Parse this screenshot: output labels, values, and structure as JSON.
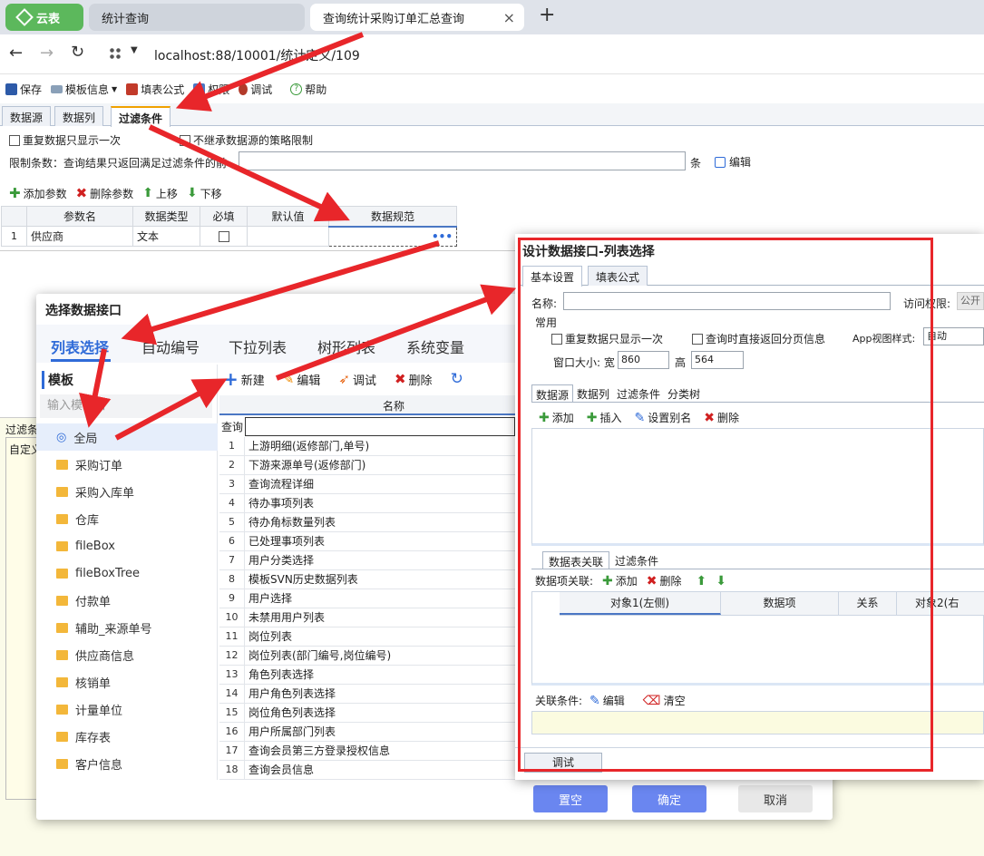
{
  "browser": {
    "tabs": [
      "云表",
      "统计查询",
      "查询统计采购订单汇总查询"
    ],
    "close": "×",
    "new_tab": "+",
    "url": "localhost:88/10001/统计定义/109"
  },
  "toolbar": {
    "save": "保存",
    "template_info": "模板信息",
    "fill_formula": "填表公式",
    "permission": "权限",
    "debug": "调试",
    "help": "帮助"
  },
  "tabs": [
    "数据源",
    "数据列",
    "过滤条件"
  ],
  "options": {
    "dedupe": "重复数据只显示一次",
    "no_inherit": "不继承数据源的策略限制",
    "limit_label": "限制条数：查询结果只返回满足过滤条件的前",
    "limit_unit": "条",
    "edit": "编辑"
  },
  "param_toolbar": {
    "add": "添加参数",
    "remove": "删除参数",
    "up": "上移",
    "down": "下移"
  },
  "param_table": {
    "headers": [
      "参数名",
      "数据类型",
      "必填",
      "默认值",
      "数据规范"
    ],
    "rows": [
      {
        "no": "1",
        "name": "供应商",
        "type": "文本",
        "dots": "•••"
      }
    ]
  },
  "left_peek": {
    "label1": "过滤条",
    "label2": "自定义"
  },
  "select_dialog": {
    "title": "选择数据接口",
    "tabs": [
      "列表选择",
      "自动编号",
      "下拉列表",
      "树形列表",
      "系统变量"
    ],
    "tree_title": "模板",
    "tree_search": "输入模板名",
    "tree_items": [
      "全局",
      "采购订单",
      "采购入库单",
      "仓库",
      "fileBox",
      "fileBoxTree",
      "付款单",
      "辅助_来源单号",
      "供应商信息",
      "核销单",
      "计量单位",
      "库存表",
      "客户信息"
    ],
    "list_toolbar": [
      "新建",
      "编辑",
      "调试",
      "删除"
    ],
    "list_header": "名称",
    "query_label": "查询",
    "list_items": [
      "上游明细(返修部门,单号)",
      "下游来源单号(返修部门)",
      "查询流程详细",
      "待办事项列表",
      "待办角标数量列表",
      "已处理事项列表",
      "用户分类选择",
      "模板SVN历史数据列表",
      "用户选择",
      "未禁用用户列表",
      "岗位列表",
      "岗位列表(部门编号,岗位编号)",
      "角色列表选择",
      "用户角色列表选择",
      "岗位角色列表选择",
      "用户所属部门列表",
      "查询会员第三方登录授权信息",
      "查询会员信息"
    ],
    "buttons": {
      "clear": "置空",
      "ok": "确定",
      "cancel": "取消"
    }
  },
  "design_dialog": {
    "title": "设计数据接口-列表选择",
    "tabs": [
      "基本设置",
      "填表公式"
    ],
    "name_label": "名称:",
    "access_label": "访问权限:",
    "access_value": "公开",
    "group": "常用",
    "dedupe": "重复数据只显示一次",
    "paging": "查询时直接返回分页信息",
    "app_view_label": "App视图样式:",
    "app_view_value": "自动",
    "size_label": "窗口大小: 宽",
    "width": "860",
    "height_label": "高",
    "height": "564",
    "inner_tabs": [
      "数据源",
      "数据列",
      "过滤条件",
      "分类树"
    ],
    "ds_toolbar": [
      "添加",
      "插入",
      "设置别名",
      "删除"
    ],
    "sub_tabs": [
      "数据表关联",
      "过滤条件"
    ],
    "link_label": "数据项关联:",
    "link_add": "添加",
    "link_remove": "删除",
    "link_headers": [
      "对象1(左侧)",
      "数据项",
      "关系",
      "对象2(右"
    ],
    "cond_label": "关联条件:",
    "cond_edit": "编辑",
    "cond_clear": "清空",
    "debug": "调试"
  },
  "colors": {
    "accent_green": "#5cb85c",
    "annotation_red": "#e8262a",
    "button_blue": "#6a86f0",
    "link_blue": "#2f6bd8"
  }
}
